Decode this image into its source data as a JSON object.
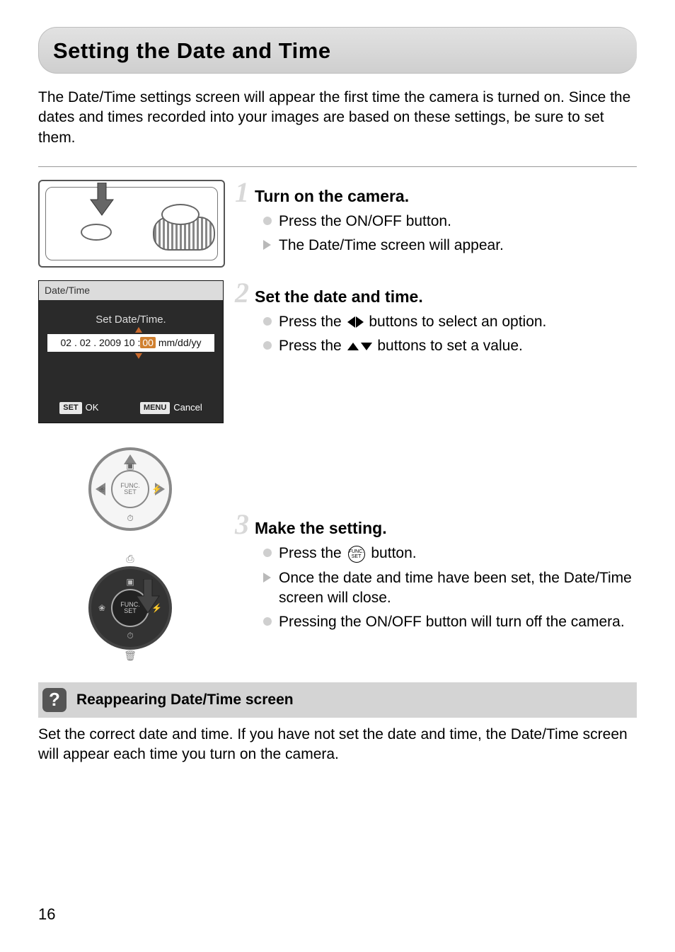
{
  "title": "Setting the Date and Time",
  "intro": "The Date/Time settings screen will appear the first time the camera is turned on. Since the dates and times recorded into your images are based on these settings, be sure to set them.",
  "lcd": {
    "header": "Date/Time",
    "prompt": "Set Date/Time.",
    "date_part1": "02 . 02 . 2009  10 :",
    "date_hl": "00",
    "date_part2": "mm/dd/yy",
    "ok_btn": "SET",
    "ok_label": "OK",
    "cancel_btn": "MENU",
    "cancel_label": "Cancel"
  },
  "func_label_top": "FUNC.",
  "func_label_bot": "SET",
  "steps": [
    {
      "num": "1",
      "title": "Turn on the camera.",
      "items": [
        {
          "type": "dot",
          "text": "Press the ON/OFF button."
        },
        {
          "type": "tri",
          "text": "The Date/Time screen will appear."
        }
      ]
    },
    {
      "num": "2",
      "title": "Set the date and time.",
      "items": [
        {
          "type": "dot",
          "pre": "Press the ",
          "glyph": "lr",
          "post": " buttons to select an option."
        },
        {
          "type": "dot",
          "pre": "Press the ",
          "glyph": "ud",
          "post": " buttons to set a value."
        }
      ]
    },
    {
      "num": "3",
      "title": "Make the setting.",
      "items": [
        {
          "type": "dot",
          "pre": "Press the ",
          "glyph": "func",
          "post": " button."
        },
        {
          "type": "tri",
          "text": "Once the date and time have been set, the Date/Time screen will close."
        },
        {
          "type": "dot",
          "text": "Pressing the ON/OFF button will turn off the camera."
        }
      ]
    }
  ],
  "note": {
    "title": "Reappearing Date/Time screen",
    "body": "Set the correct date and time. If you have not set the date and time, the Date/Time screen will appear each time you turn on the camera."
  },
  "page_number": "16"
}
